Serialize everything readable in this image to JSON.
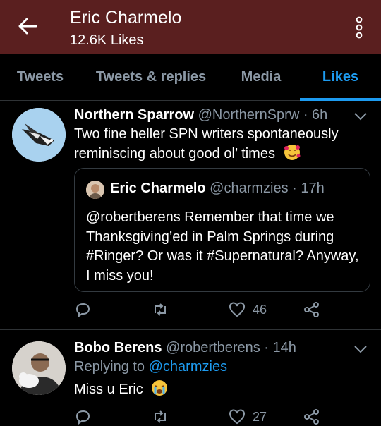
{
  "header": {
    "title": "Eric Charmelo",
    "subtitle": "12.6K Likes",
    "colors": {
      "background": "#5a1f1f"
    }
  },
  "tabs": [
    {
      "label": "Tweets"
    },
    {
      "label": "Tweets & replies"
    },
    {
      "label": "Media"
    },
    {
      "label": "Likes",
      "active": true
    }
  ],
  "tweets": [
    {
      "name": "Northern Sparrow",
      "handle": "@NorthernSprw",
      "time": "· 6h",
      "text": "Two fine heller SPN writers spontaneously reminiscing about good ol’ times",
      "emoji": "smiling-hearts-emoji",
      "quote": {
        "name": "Eric Charmelo",
        "handle": "@charmzies",
        "time": "· 17h",
        "text": "@robertberens Remember that time we Thanksgiving’ed in Palm Springs during #Ringer? Or was it #Supernatural? Anyway, I miss you!"
      },
      "likes": "46"
    },
    {
      "name": "Bobo Berens",
      "handle": "@robertberens",
      "time": "· 14h",
      "replying_prefix": "Replying to",
      "replying_to": "@charmzies",
      "text": "Miss u Eric",
      "emoji": "crying-emoji",
      "likes": "27"
    }
  ],
  "colors": {
    "accent": "#1d9bf0",
    "muted": "#8b98a5",
    "divider": "#2f3336"
  }
}
